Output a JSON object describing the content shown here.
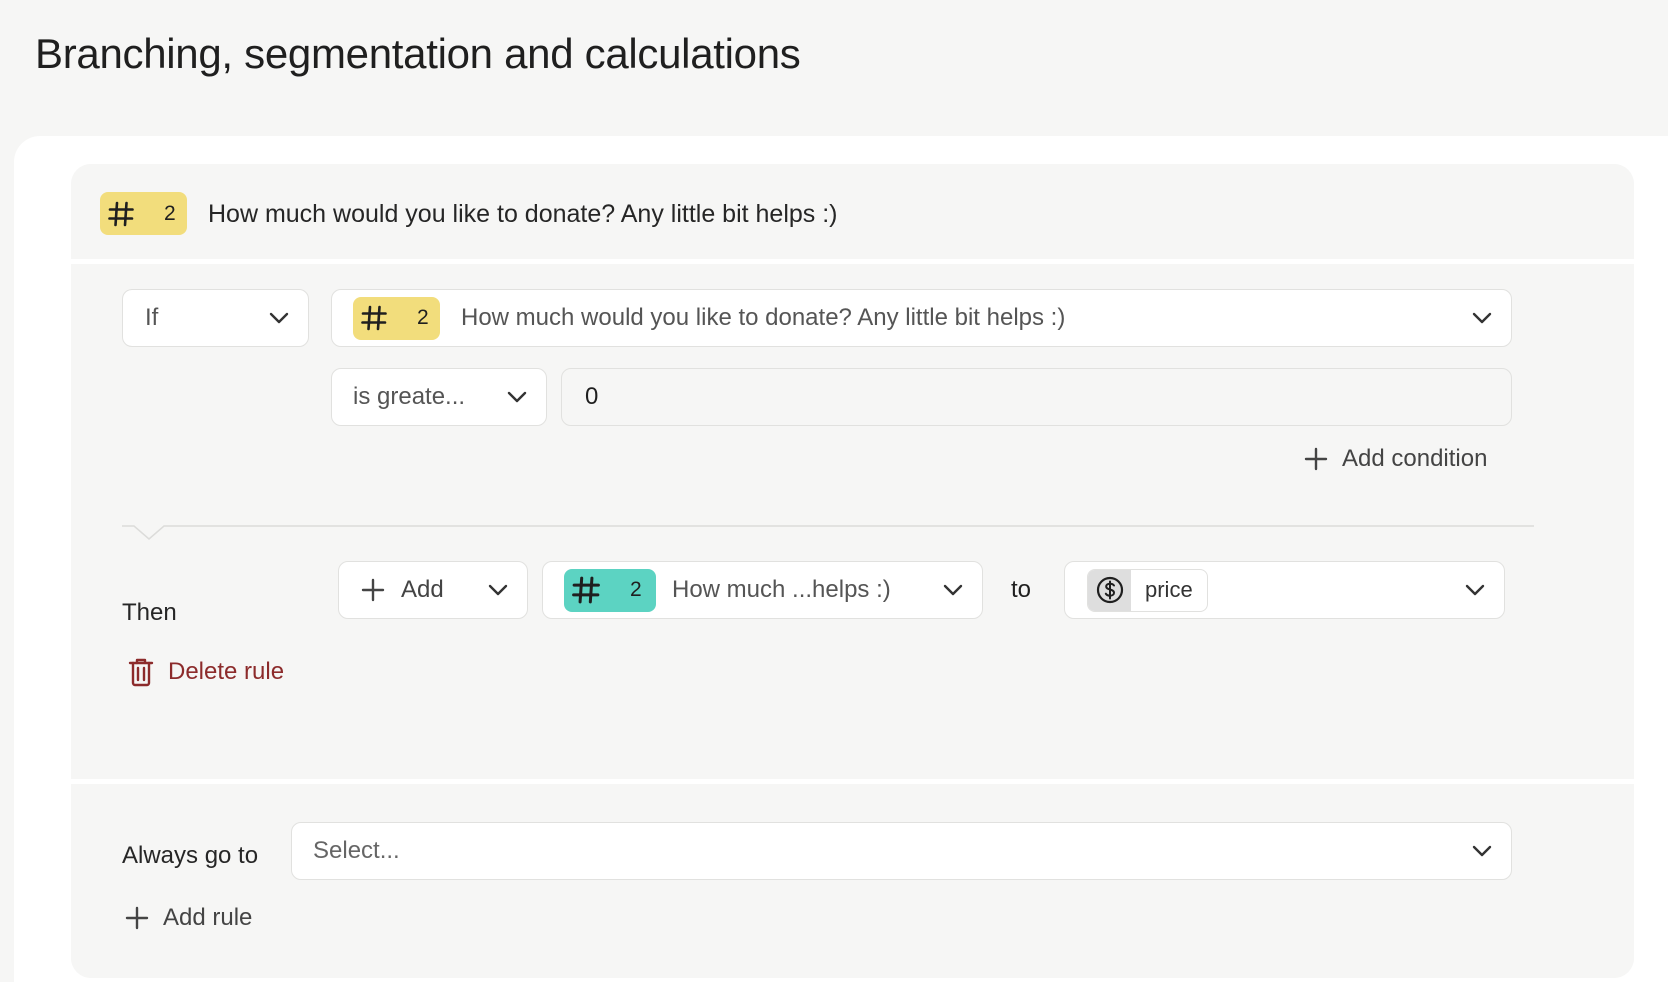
{
  "page": {
    "title": "Branching, segmentation and calculations"
  },
  "question": {
    "number": "2",
    "type_icon": "hash-icon",
    "title": "How much would you like to donate? Any little bit helps :)",
    "badge_color": "#f2dd7c"
  },
  "rule": {
    "if_label": "If",
    "condition_field": {
      "number": "2",
      "icon": "hash-icon",
      "label": "How much would you like to donate? Any little bit helps :)"
    },
    "operator_label": "is greate...",
    "value": "0",
    "add_condition_label": "Add condition",
    "then_label": "Then",
    "action_label": "Add",
    "target": {
      "number": "2",
      "icon": "hash-icon",
      "label": "How much ...helps :)",
      "badge_color": "#5cd3c2"
    },
    "to_label": "to",
    "variable": {
      "icon": "dollar-circle-icon",
      "name": "price"
    },
    "delete_label": "Delete rule",
    "delete_color": "#8c2b2b"
  },
  "footer": {
    "always_label": "Always go to",
    "goto_placeholder": "Select...",
    "add_rule_label": "Add rule"
  }
}
